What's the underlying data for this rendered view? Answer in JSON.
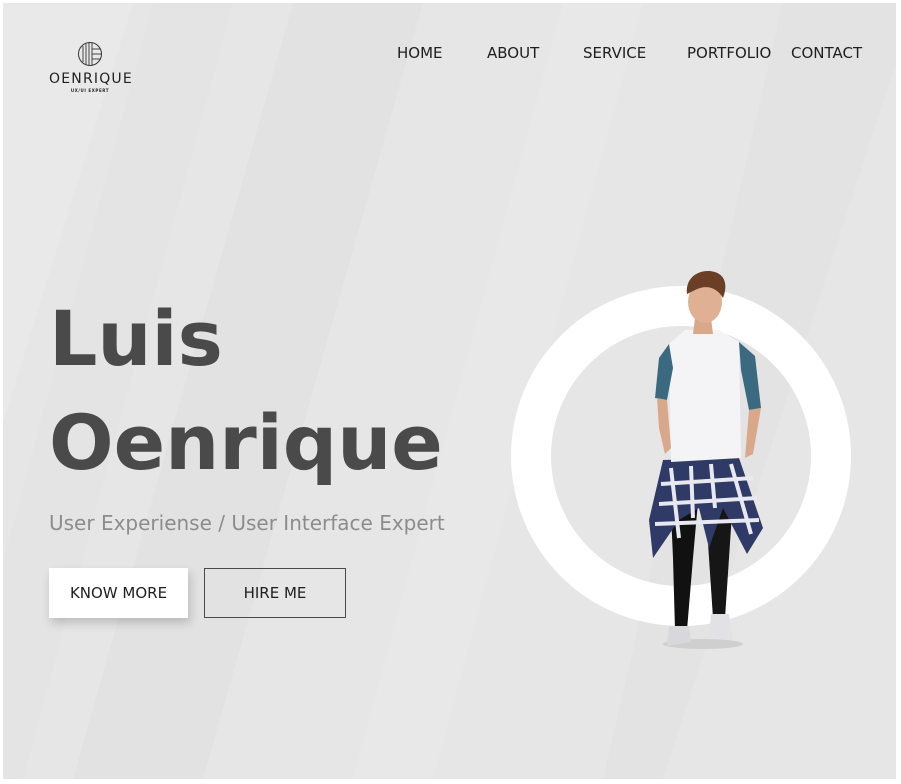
{
  "logo": {
    "name": "OENRIQUE",
    "tagline": "UX/UI EXPERT"
  },
  "nav": {
    "items": [
      "HOME",
      "ABOUT",
      "SERVICE",
      "PORTFOLIO",
      "CONTACT"
    ]
  },
  "hero": {
    "first_name": "Luis",
    "last_name": "Oenrique",
    "subtitle": "User Experiense / User Interface Expert",
    "primary_button": "KNOW MORE",
    "secondary_button": "HIRE ME"
  },
  "colors": {
    "background": "#e6e6e6",
    "heading": "#4a4a4a",
    "subtitle": "#8c8c8c",
    "ring": "#ffffff",
    "shirt_sleeve": "#3b6a80"
  },
  "icons": [
    "logo-mark-icon"
  ]
}
